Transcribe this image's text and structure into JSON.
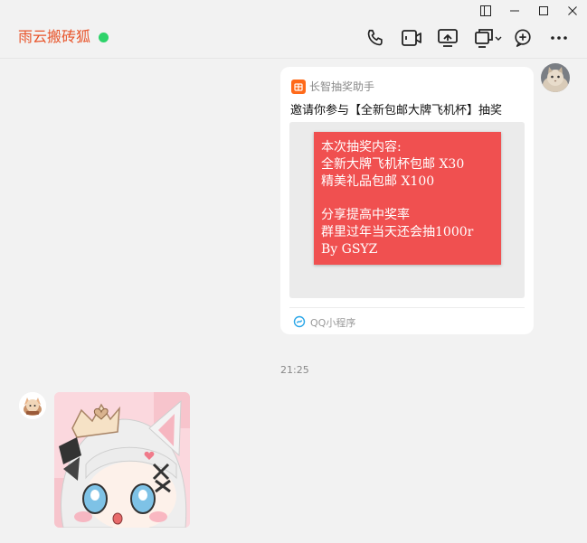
{
  "chat": {
    "name": "雨云搬砖狐",
    "status_color": "#2ed36a"
  },
  "toolbar": {
    "icons": [
      "phone-icon",
      "video-call-icon",
      "screen-share-icon",
      "remote-assist-icon",
      "add-circle-icon",
      "more-icon"
    ]
  },
  "window_controls": [
    "sidebar-toggle-icon",
    "minimize-icon",
    "maximize-icon",
    "close-icon"
  ],
  "messages": [
    {
      "type": "mini-program-card",
      "sender": "self",
      "app_name": "长智抽奖助手",
      "title": "邀请你参与【全新包邮大牌飞机杯】抽奖",
      "preview_lines": [
        "本次抽奖内容:",
        "全新大牌飞机杯包邮 X30",
        "精美礼品包邮 X100",
        "",
        "分享提高中奖率",
        "群里过年当天还会抽1000r",
        "By GSYZ"
      ],
      "footer_label": "QQ小程序"
    },
    {
      "type": "timestamp",
      "text": "21:25"
    },
    {
      "type": "sticker",
      "sender": "other",
      "description": "anime-girl-sticker"
    }
  ],
  "colors": {
    "accent": "#e8542a",
    "app_icon": "#ff6a1a",
    "preview_red": "#f05050"
  }
}
